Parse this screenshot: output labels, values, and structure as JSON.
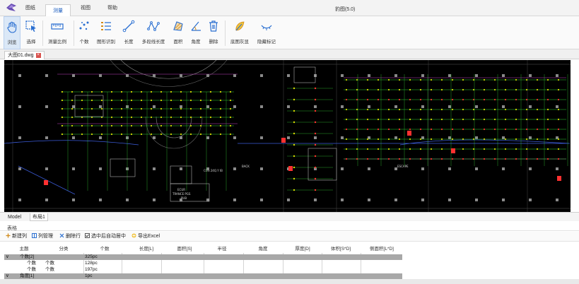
{
  "menu": {
    "tabs": [
      {
        "label": "图纸"
      },
      {
        "label": "测量"
      },
      {
        "label": "视图"
      },
      {
        "label": "帮助"
      }
    ],
    "active_tab": "测量",
    "window_title": "豹图(5.0)"
  },
  "ribbon": {
    "tools": [
      {
        "label": "浏览",
        "icon": "hand-icon",
        "active": true
      },
      {
        "label": "选择",
        "icon": "select-cursor-icon",
        "active": false
      },
      {
        "label": "测量比例",
        "icon": "ruler-scale-icon",
        "active": false
      },
      {
        "label": "个数",
        "icon": "count-dots-icon",
        "active": false
      },
      {
        "label": "图形识别",
        "icon": "shape-recognition-icon",
        "active": false
      },
      {
        "label": "长度",
        "icon": "length-line-icon",
        "active": false
      },
      {
        "label": "多段线长度",
        "icon": "polyline-length-icon",
        "active": false
      },
      {
        "label": "面积",
        "icon": "area-icon",
        "active": false
      },
      {
        "label": "角度",
        "icon": "angle-icon",
        "active": false
      },
      {
        "label": "删除",
        "icon": "trash-icon",
        "active": false
      },
      {
        "label": "底图灰显",
        "icon": "gray-basemap-icon",
        "active": false
      },
      {
        "label": "隐藏标记",
        "icon": "hide-marks-icon",
        "active": false
      }
    ]
  },
  "document": {
    "tab_label": "大图01.dwg",
    "layout_tabs": [
      "Model",
      "布局1"
    ]
  },
  "drawing": {
    "labels": [
      "ECUR",
      "TRANCE PGS",
      "PUB",
      "COS 24Q.Y IB",
      "BACK",
      "ESCAPE"
    ]
  },
  "table_panel": {
    "title": "表格",
    "toolbar": [
      {
        "label": "新建列",
        "icon": "new-column-icon"
      },
      {
        "label": "列管理",
        "icon": "column-manage-icon"
      },
      {
        "label": "删除行",
        "icon": "delete-row-icon"
      },
      {
        "label": "选中后自动居中",
        "icon": "checkbox-icon"
      },
      {
        "label": "导出Excel",
        "icon": "export-excel-icon"
      }
    ],
    "columns": [
      "主题",
      "分类",
      "个数",
      "长度[L]",
      "面积[S]",
      "半径",
      "角度",
      "厚度[D]",
      "体积[S*D]",
      "侧面积[L*D]"
    ],
    "rows": [
      {
        "type": "group",
        "expander": "∨",
        "subject": "个数[2]",
        "category": "",
        "count": "325pc"
      },
      {
        "type": "item",
        "subject": "个数",
        "category": "个数",
        "count": "128pc"
      },
      {
        "type": "item",
        "subject": "个数",
        "category": "个数",
        "count": "197pc"
      },
      {
        "type": "group",
        "expander": "∨",
        "subject": "角度[1]",
        "category": "",
        "count": "1pc"
      }
    ]
  },
  "colors": {
    "accent": "#1f5fbf",
    "drawing_bg": "#000000",
    "group_row": "#a8a8a8",
    "cad_green": "#33cc33",
    "cad_yellow": "#d8d800",
    "cad_red": "#ff3030",
    "cad_magenta": "#d040d0"
  }
}
